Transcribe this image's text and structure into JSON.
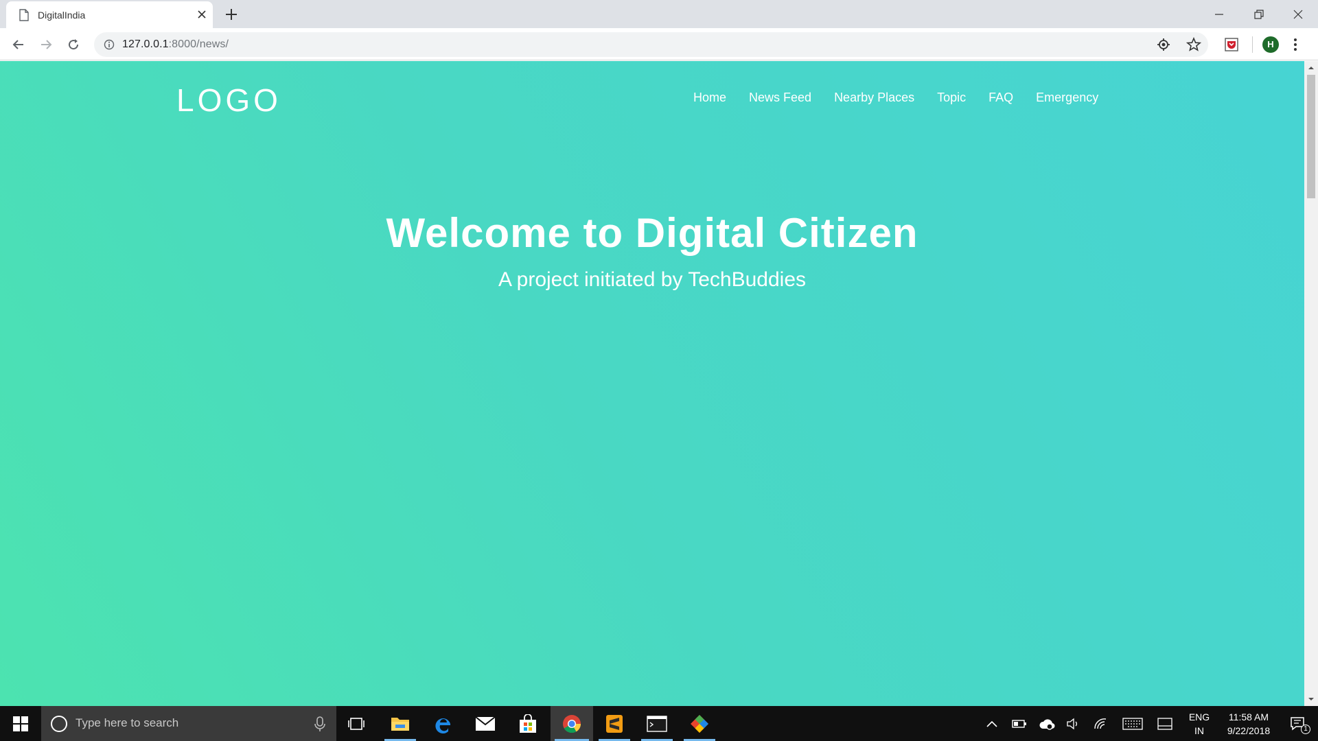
{
  "browser": {
    "tab_title": "DigitalIndia",
    "url_host": "127.0.0.1",
    "url_path": ":8000/news/",
    "profile_initial": "H"
  },
  "header": {
    "logo": "LOGO",
    "nav": [
      "Home",
      "News Feed",
      "Nearby Places",
      "Topic",
      "FAQ",
      "Emergency"
    ]
  },
  "hero": {
    "title": "Welcome to Digital Citizen",
    "subtitle": "A project initiated by TechBuddies"
  },
  "taskbar": {
    "search_placeholder": "Type here to search",
    "language_line1": "ENG",
    "language_line2": "IN",
    "time": "11:58 AM",
    "date": "9/22/2018",
    "notification_count": "1"
  },
  "colors": {
    "gradient_start": "#4ce3b0",
    "gradient_end": "#47d4d3"
  }
}
